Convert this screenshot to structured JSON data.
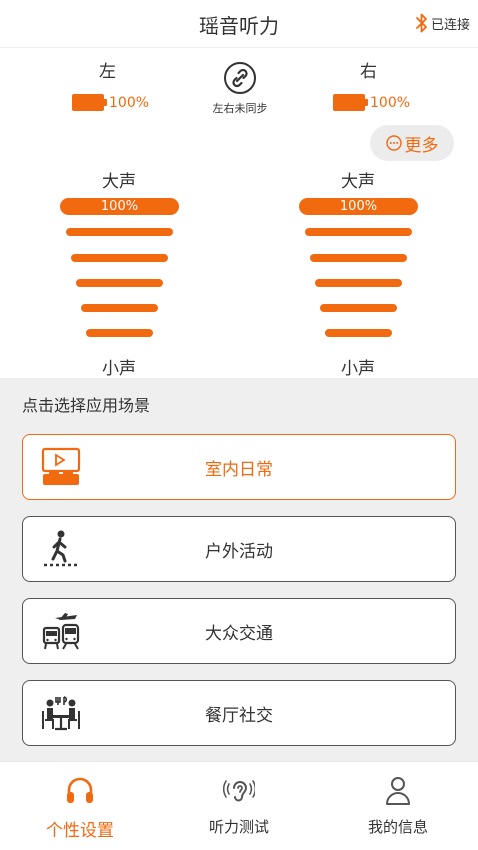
{
  "header": {
    "title": "瑶音听力",
    "bt_status": "已连接"
  },
  "colors": {
    "accent": "#f26a10"
  },
  "left": {
    "label": "左",
    "battery": "100%",
    "loud_label": "大声",
    "quiet_label": "小声",
    "volume_value": "100%"
  },
  "right": {
    "label": "右",
    "battery": "100%",
    "loud_label": "大声",
    "quiet_label": "小声",
    "volume_value": "100%"
  },
  "sync": {
    "label": "左右未同步",
    "icon": "link-icon"
  },
  "more": {
    "label": "更多",
    "icon": "ellipsis-circle-icon"
  },
  "scenes": {
    "hint": "点击选择应用场景",
    "items": [
      {
        "label": "室内日常",
        "icon": "home-tv-icon",
        "active": true
      },
      {
        "label": "户外活动",
        "icon": "walking-person-icon",
        "active": false
      },
      {
        "label": "大众交通",
        "icon": "transport-icon",
        "active": false
      },
      {
        "label": "餐厅社交",
        "icon": "restaurant-icon",
        "active": false
      }
    ]
  },
  "tabs": [
    {
      "label": "个性设置",
      "icon": "headphones-icon",
      "active": true
    },
    {
      "label": "听力测试",
      "icon": "ear-icon",
      "active": false
    },
    {
      "label": "我的信息",
      "icon": "user-icon",
      "active": false
    }
  ]
}
